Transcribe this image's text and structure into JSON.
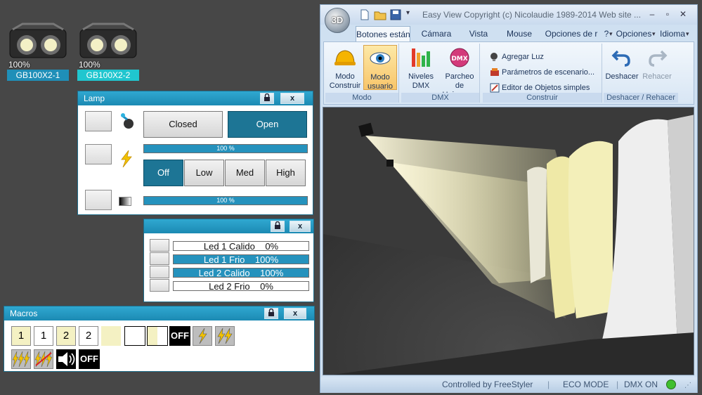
{
  "fixtures": [
    {
      "percent": "100%",
      "name": "GB100X2-1",
      "color": "#1f8fb8"
    },
    {
      "percent": "100%",
      "name": "GB100X2-2",
      "color": "#20c6cf"
    }
  ],
  "lamp_panel": {
    "title": "Lamp",
    "close_label": "x",
    "shutter": {
      "closed": "Closed",
      "open": "Open",
      "selected": "Open"
    },
    "dimmer_pct": 100,
    "dimmer_text": "100 %",
    "strobe": {
      "off": "Off",
      "low": "Low",
      "med": "Med",
      "high": "High",
      "selected": "Off"
    },
    "fade_pct": 100,
    "fade_text": "100 %"
  },
  "led_panel": {
    "close_label": "x",
    "rows": [
      {
        "label": "Led 1 Calido",
        "value": "0%",
        "pct": 0
      },
      {
        "label": "Led 1 Frio",
        "value": "100%",
        "pct": 100
      },
      {
        "label": "Led 2 Calido",
        "value": "100%",
        "pct": 100
      },
      {
        "label": "Led 2 Frio",
        "value": "0%",
        "pct": 0
      }
    ]
  },
  "macros_panel": {
    "title": "Macros",
    "close_label": "x",
    "row1": [
      "1",
      "1",
      "2",
      "2",
      "",
      "",
      "",
      "OFF",
      "",
      ""
    ],
    "row2": [
      "",
      "",
      "",
      "OFF"
    ]
  },
  "app": {
    "logo_text": "3D",
    "title": "Easy View   Copyright (c) Nicolaudie 1989-2014   Web site ...",
    "tabs": [
      "Botones están",
      "Cámara",
      "Vista",
      "Mouse",
      "Opciones de r"
    ],
    "help_label": "?",
    "opciones_label": "Opciones",
    "idioma_label": "Idioma",
    "groups": {
      "modo": {
        "label": "Modo",
        "construir": "Modo Construir",
        "usuario": "Modo usuario"
      },
      "dmx": {
        "label": "DMX",
        "niveles": "Niveles DMX",
        "parcheo": "Parcheo de Universos"
      },
      "construir": {
        "label": "Construir",
        "agregar": "Agregar Luz",
        "parametros": "Parámetros de escenario...",
        "editor": "Editor de Objetos simples"
      },
      "undo": {
        "label": "Deshacer / Rehacer",
        "deshacer": "Deshacer",
        "rehacer": "Rehacer"
      }
    },
    "status": {
      "controlled": "Controlled by FreeStyler",
      "eco": "ECO MODE",
      "dmx": "DMX ON",
      "dmx_color": "#3fbf2e"
    }
  }
}
